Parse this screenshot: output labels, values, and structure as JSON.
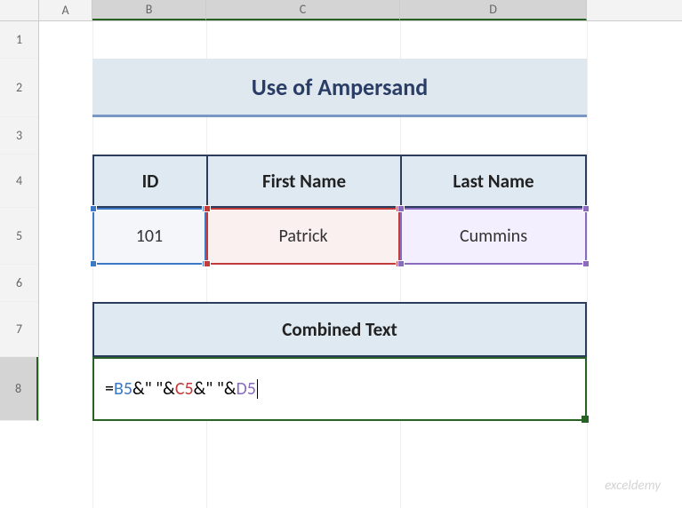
{
  "columns": {
    "corner": "",
    "a": "A",
    "b": "B",
    "c": "C",
    "d": "D"
  },
  "rows": {
    "r1": "1",
    "r2": "2",
    "r3": "3",
    "r4": "4",
    "r5": "5",
    "r6": "6",
    "r7": "7",
    "r8": "8"
  },
  "title": "Use of Ampersand",
  "headers": {
    "id": "ID",
    "first_name": "First Name",
    "last_name": "Last Name"
  },
  "data_row": {
    "id": "101",
    "first_name": "Patrick",
    "last_name": "Cummins"
  },
  "combined_header": "Combined Text",
  "formula": {
    "eq": "=",
    "ref_b5": "B5",
    "amp_sp1": "&\" \"&",
    "ref_c5": "C5",
    "amp_sp2": "&\" \"&",
    "ref_d5": "D5"
  },
  "colors": {
    "ref_b5": "#3c78c3",
    "ref_c5": "#c23b3b",
    "ref_d5": "#8a6bbd",
    "active_border": "#276124"
  },
  "watermark": "exceldemy",
  "chart_data": {
    "type": "table",
    "title": "Use of Ampersand",
    "columns": [
      "ID",
      "First Name",
      "Last Name"
    ],
    "rows": [
      {
        "ID": 101,
        "First Name": "Patrick",
        "Last Name": "Cummins"
      }
    ],
    "combined_header": "Combined Text",
    "combined_formula": "=B5&\" \"&C5&\" \"&D5"
  }
}
